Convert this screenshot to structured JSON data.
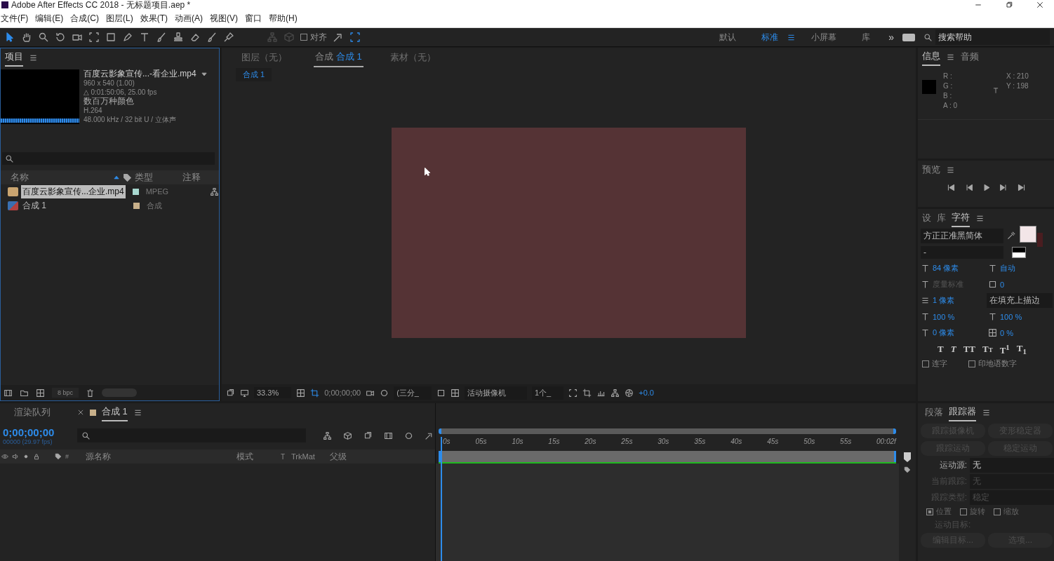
{
  "window": {
    "title": "Adobe After Effects CC 2018 - 无标题项目.aep *"
  },
  "menu": [
    "文件(F)",
    "编辑(E)",
    "合成(C)",
    "图层(L)",
    "效果(T)",
    "动画(A)",
    "视图(V)",
    "窗口",
    "帮助(H)"
  ],
  "toolbar": {
    "align": {
      "label": "对齐",
      "checked": false
    },
    "workspaces": [
      {
        "label": "默认",
        "selected": false
      },
      {
        "label": "标准",
        "selected": true
      },
      {
        "label": "小屏幕",
        "selected": false
      },
      {
        "label": "库",
        "selected": false
      }
    ],
    "overflow": "»",
    "search": {
      "placeholder": "搜索帮助"
    }
  },
  "project": {
    "tab": "项目",
    "footage": {
      "name": "百度云影象宣传...-看企业.mp4",
      "size": "960 x 540 (1.00)",
      "duration": "△ 0:01:50:06, 25.00 fps",
      "colors": "数百万种颜色",
      "codec": "H.264",
      "audio": "48.000 kHz / 32 bit U / 立体声"
    },
    "columns": [
      "名称",
      "类型",
      "注释"
    ],
    "items": [
      {
        "kind": "footage",
        "name": "百度云影象宣传...企业.mp4",
        "type": "MPEG",
        "color": "#a8d8d0",
        "selected": true
      },
      {
        "kind": "composition",
        "name": "合成 1",
        "type": "合成",
        "color": "#c8b08a",
        "selected": false
      }
    ],
    "bpc": "8 bpc"
  },
  "viewer": {
    "tabs": [
      {
        "label": "图层（无）",
        "selected": false
      },
      {
        "label": "合成",
        "comp": "合成 1",
        "selected": true
      },
      {
        "label": "素材（无）",
        "selected": false
      }
    ],
    "breadcrumb": "合成 1",
    "controls": {
      "zoom": "33.3%",
      "timecode": "0;00;00;00",
      "resolution": "(三分_",
      "camera": "活动摄像机",
      "views": "1个_",
      "exposure": "+0.0"
    }
  },
  "info": {
    "tabs": [
      {
        "label": "信息",
        "selected": true
      },
      {
        "label": "音频",
        "selected": false
      }
    ],
    "channels": [
      "R :",
      "G :",
      "B :",
      "A : 0"
    ],
    "coords": [
      "X : 210",
      "Y : 198"
    ]
  },
  "preview": {
    "title": "预览"
  },
  "character": {
    "tabs": [
      {
        "label": "设",
        "selected": false
      },
      {
        "label": "库",
        "selected": false
      },
      {
        "label": "字符",
        "selected": true
      }
    ],
    "font": "方正正准黑简体",
    "style": "-",
    "size": "84 像素",
    "leading": "自动",
    "kerning": "度量标准",
    "tracking": "0",
    "stroke_width": "1 像素",
    "stroke_mode": "在填充上描边",
    "vertical_scale": "100 %",
    "horizontal_scale": "100 %",
    "baseline_shift": "0 像素",
    "tsume": "0 %",
    "style_buttons": [
      "T",
      "T",
      "TT",
      "Tт",
      "T$^{1}$",
      "T$_{1}$"
    ],
    "options": [
      {
        "label": "连字",
        "checked": false
      },
      {
        "label": "印地语数字",
        "checked": false
      }
    ]
  },
  "timeline": {
    "tabs": [
      {
        "label": "渲染队列",
        "selected": false
      },
      {
        "label": "合成 1",
        "selected": true
      }
    ],
    "timecode": "0;00;00;00",
    "fps": "00000 (29.97 fps)",
    "columns": [
      "#",
      "源名称",
      "模式",
      "T",
      "TrkMat",
      "父级"
    ],
    "ruler": [
      "0s",
      "05s",
      "10s",
      "15s",
      "20s",
      "25s",
      "30s",
      "35s",
      "40s",
      "45s",
      "50s",
      "55s",
      "00:02f"
    ]
  },
  "tracker": {
    "tabs": [
      {
        "label": "段落",
        "selected": false
      },
      {
        "label": "跟踪器",
        "selected": true
      }
    ],
    "buttons": [
      {
        "label": "跟踪摄像机",
        "disabled": true
      },
      {
        "label": "变形稳定器",
        "disabled": true
      },
      {
        "label": "跟踪运动",
        "disabled": true
      },
      {
        "label": "稳定运动",
        "disabled": true
      }
    ],
    "fields": [
      {
        "label": "运动源:",
        "value": "无",
        "disabled": false
      },
      {
        "label": "当前跟踪:",
        "value": "无",
        "disabled": true
      },
      {
        "label": "跟踪类型:",
        "value": "稳定",
        "disabled": true
      }
    ],
    "checks": [
      {
        "label": "位置",
        "checked": true
      },
      {
        "label": "旋转",
        "checked": false
      },
      {
        "label": "缩放",
        "checked": false
      }
    ],
    "target_label": "运动目标:",
    "actions": [
      {
        "label": "编辑目标...",
        "disabled": true
      },
      {
        "label": "选项...",
        "disabled": true
      }
    ]
  }
}
